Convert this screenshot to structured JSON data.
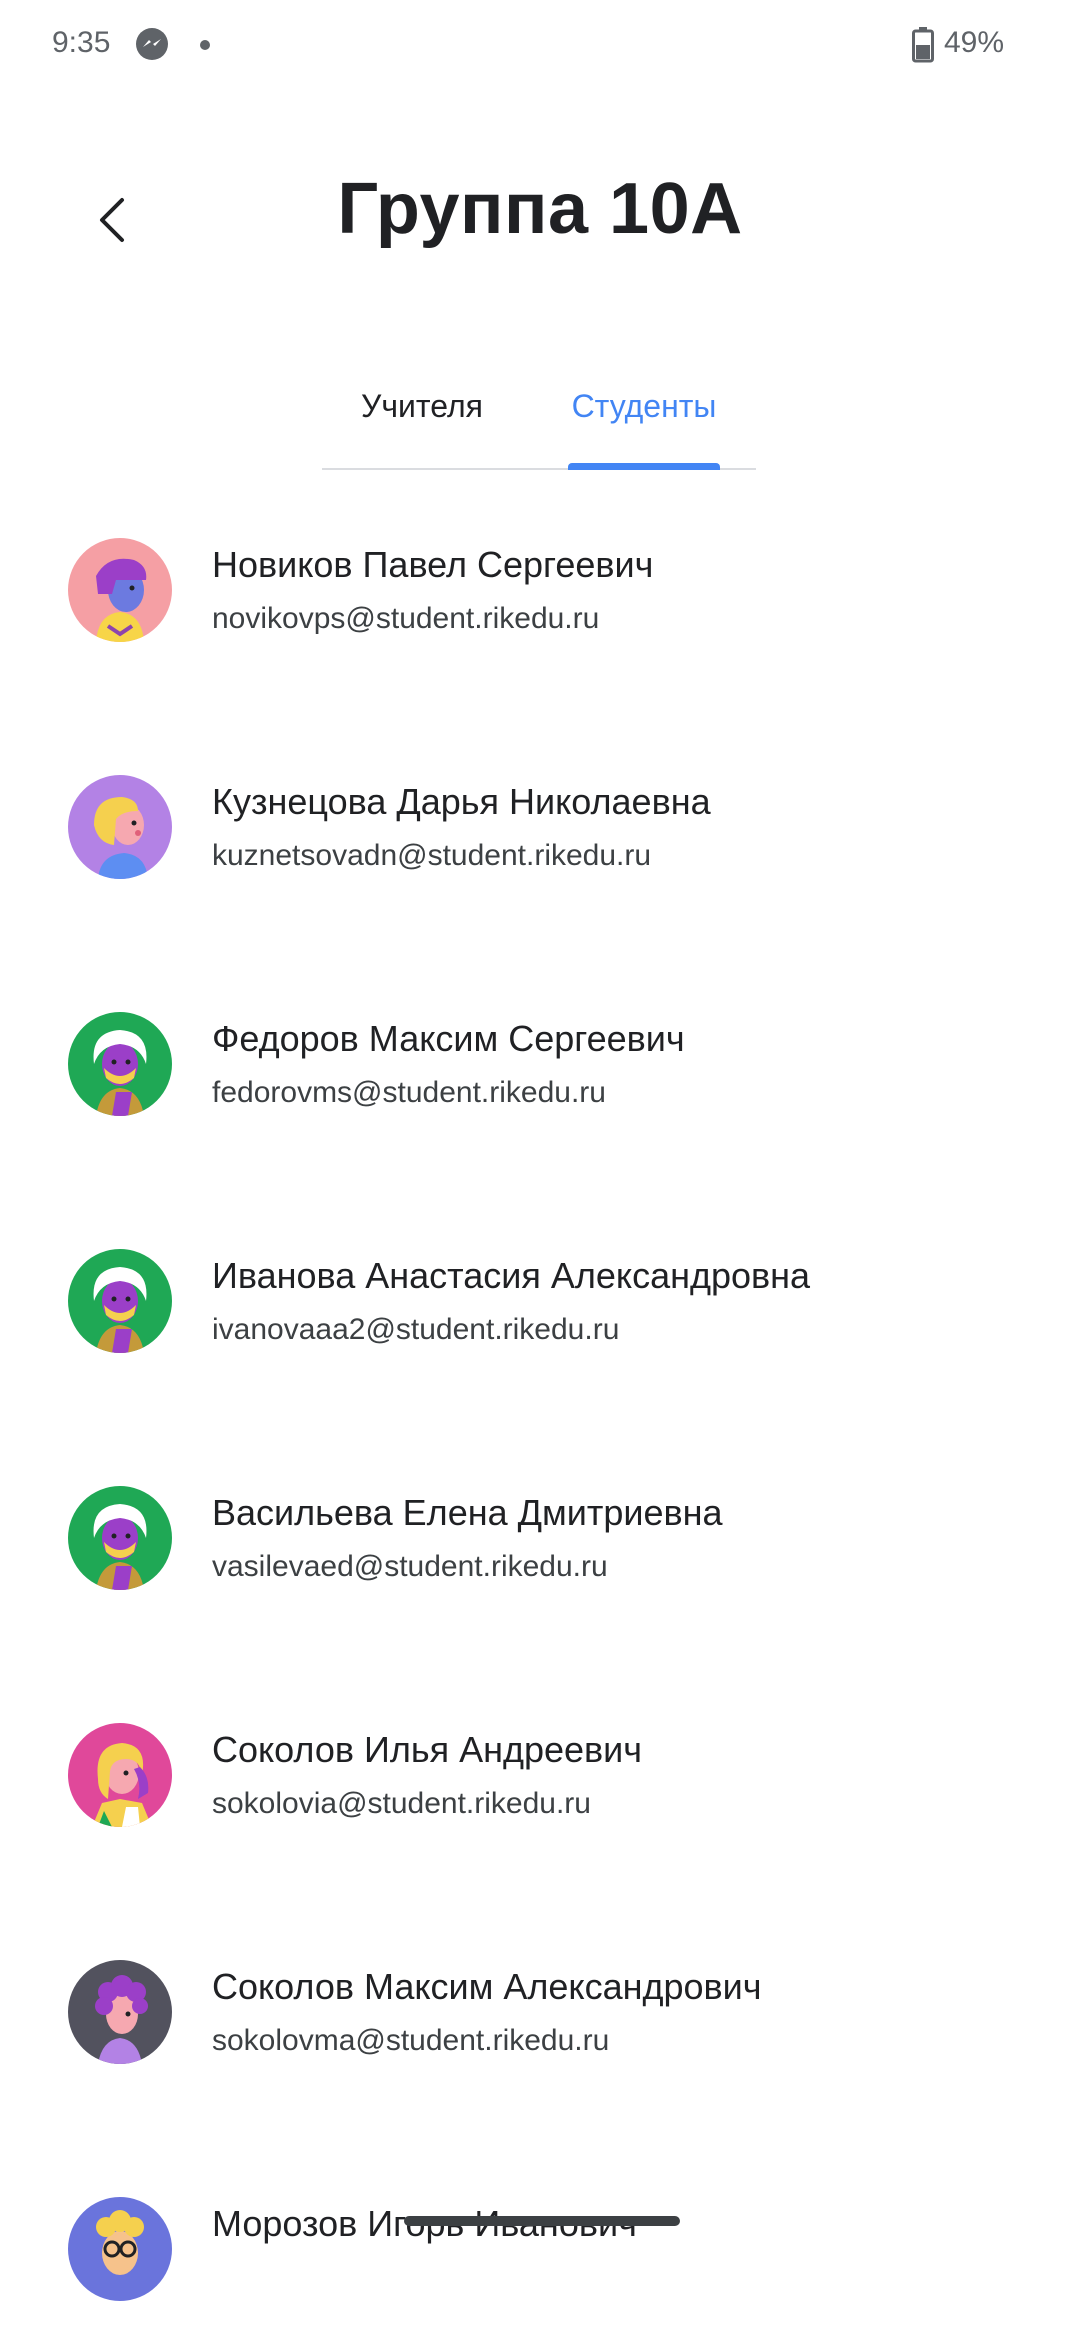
{
  "status_bar": {
    "time": "9:35",
    "battery": "49%",
    "icons": [
      "messenger-icon",
      "dot-icon",
      "battery-icon"
    ]
  },
  "header": {
    "title": "Группа 10А",
    "back_icon": "chevron-left-icon"
  },
  "tabs": [
    {
      "label": "Учителя",
      "active": false
    },
    {
      "label": "Студенты",
      "active": true
    }
  ],
  "colors": {
    "accent": "#4285f4",
    "text_primary": "#202124",
    "text_secondary": "#3c4043",
    "divider": "#dadce0"
  },
  "students": [
    {
      "name": "Новиков Павел Сергеевич",
      "email": "novikovps@student.rikedu.ru",
      "avatar": "avatar-purple-hair-icon",
      "avatar_bg": "#f59fa4"
    },
    {
      "name": "Кузнецова Дарья Николаевна",
      "email": "kuznetsovadn@student.rikedu.ru",
      "avatar": "avatar-yellow-hair-icon",
      "avatar_bg": "#b382e5"
    },
    {
      "name": "Федоров Максим Сергеевич",
      "email": "fedorovms@student.rikedu.ru",
      "avatar": "avatar-white-hair-icon",
      "avatar_bg": "#1fa855"
    },
    {
      "name": "Иванова Анастасия Александровна",
      "email": "ivanovaaa2@student.rikedu.ru",
      "avatar": "avatar-white-hair-icon",
      "avatar_bg": "#1fa855"
    },
    {
      "name": "Васильева Елена Дмитриевна",
      "email": "vasilevaed@student.rikedu.ru",
      "avatar": "avatar-white-hair-icon",
      "avatar_bg": "#1fa855"
    },
    {
      "name": "Соколов Илья Андреевич",
      "email": "sokolovia@student.rikedu.ru",
      "avatar": "avatar-blonde-hair-icon",
      "avatar_bg": "#e0489a"
    },
    {
      "name": "Соколов Максим Александрович",
      "email": "sokolovma@student.rikedu.ru",
      "avatar": "avatar-purple-curly-icon",
      "avatar_bg": "#52525e"
    },
    {
      "name": "Морозов Игорь Иванович",
      "email": "",
      "avatar": "avatar-glasses-icon",
      "avatar_bg": "#6a74dc"
    }
  ]
}
